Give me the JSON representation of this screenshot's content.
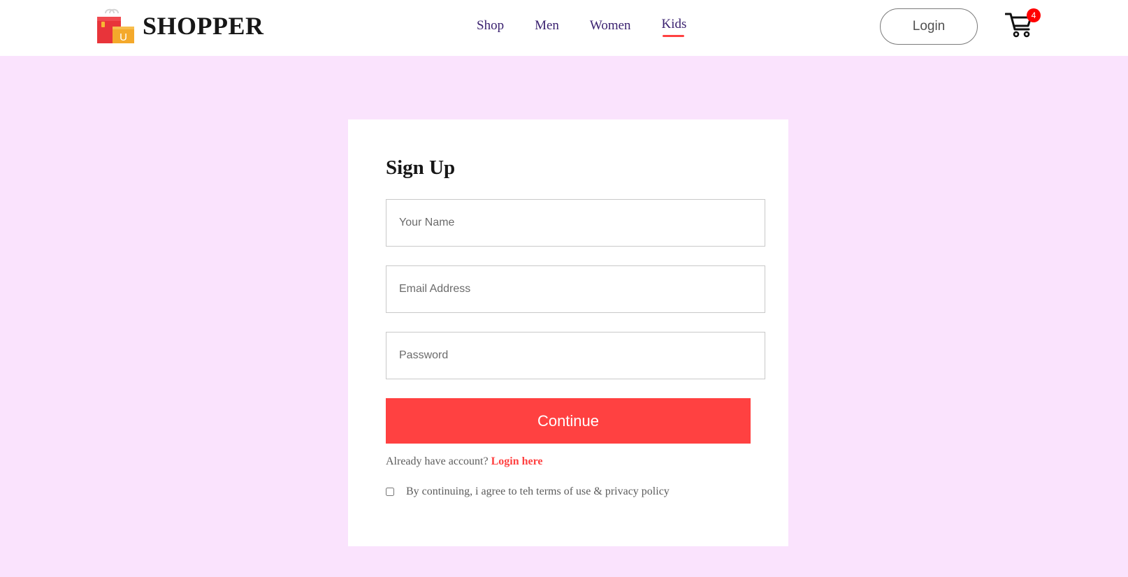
{
  "navbar": {
    "logo_text": "SHOPPER",
    "logo_icon": "shopping-bag-icon",
    "menu": [
      {
        "label": "Shop"
      },
      {
        "label": "Men"
      },
      {
        "label": "Women"
      },
      {
        "label": "Kids",
        "active": true
      }
    ],
    "login_label": "Login",
    "cart_icon": "shopping-cart-icon",
    "cart_count": "4"
  },
  "signup": {
    "title": "Sign Up",
    "name_placeholder": "Your Name",
    "email_placeholder": "Email Address",
    "password_placeholder": "Password",
    "continue_label": "Continue",
    "already_text": "Already have account?",
    "login_link": "Login here",
    "agree_text": "By continuing, i agree to teh terms of use & privacy policy"
  },
  "colors": {
    "background": "#fae3fd",
    "accent": "#ff4141",
    "nav_text": "#3b2270",
    "badge": "#ff0000"
  }
}
